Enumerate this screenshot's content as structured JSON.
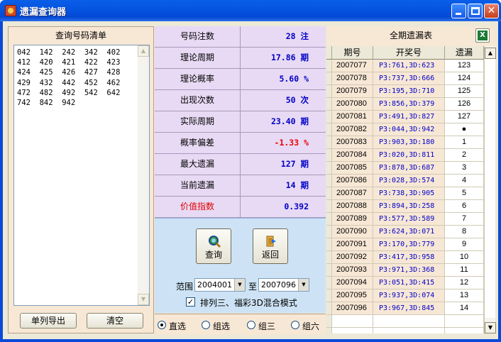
{
  "window": {
    "title": "遗漏查询器"
  },
  "left": {
    "header": "查询号码清单",
    "list_text": "042  142  242  342  402\n412  420  421  422  423\n424  425  426  427  428\n429  432  442  452  462\n472  482  492  542  642\n742  842  942",
    "export_button": "单列导出",
    "clear_button": "清空"
  },
  "stats": [
    {
      "label": "号码注数",
      "value": "28 注"
    },
    {
      "label": "理论周期",
      "value": "17.86 期"
    },
    {
      "label": "理论概率",
      "value": "5.60  %"
    },
    {
      "label": "出现次数",
      "value": "50 次"
    },
    {
      "label": "实际周期",
      "value": "23.40 期"
    },
    {
      "label": "概率偏差",
      "value": "-1.33 %"
    },
    {
      "label": "最大遗漏",
      "value": "127 期"
    },
    {
      "label": "当前遗漏",
      "value": "14 期"
    },
    {
      "label": "价值指数",
      "value": "0.392"
    }
  ],
  "actions": {
    "query": "查询",
    "back": "返回"
  },
  "range": {
    "label": "范围",
    "from": "2004001",
    "to_label": "至",
    "to": "2007096",
    "mixed_mode_label": "排列三、福彩3D混合模式",
    "mixed_mode_checked": true
  },
  "modes": [
    {
      "label": "直选",
      "selected": true
    },
    {
      "label": "组选",
      "selected": false
    },
    {
      "label": "组三",
      "selected": false
    },
    {
      "label": "组六",
      "selected": false
    }
  ],
  "table": {
    "title": "全期遗漏表",
    "export_icon": "excel-icon",
    "columns": [
      "期号",
      "开奖号",
      "遗漏"
    ],
    "rows": [
      [
        "2007077",
        "P3:761,3D:623",
        "123"
      ],
      [
        "2007078",
        "P3:737,3D:666",
        "124"
      ],
      [
        "2007079",
        "P3:195,3D:710",
        "125"
      ],
      [
        "2007080",
        "P3:856,3D:379",
        "126"
      ],
      [
        "2007081",
        "P3:491,3D:827",
        "127"
      ],
      [
        "2007082",
        "P3:044,3D:942",
        "●"
      ],
      [
        "2007083",
        "P3:903,3D:180",
        "1"
      ],
      [
        "2007084",
        "P3:020,3D:811",
        "2"
      ],
      [
        "2007085",
        "P3:878,3D:687",
        "3"
      ],
      [
        "2007086",
        "P3:028,3D:574",
        "4"
      ],
      [
        "2007087",
        "P3:738,3D:905",
        "5"
      ],
      [
        "2007088",
        "P3:894,3D:258",
        "6"
      ],
      [
        "2007089",
        "P3:577,3D:589",
        "7"
      ],
      [
        "2007090",
        "P3:624,3D:071",
        "8"
      ],
      [
        "2007091",
        "P3:170,3D:779",
        "9"
      ],
      [
        "2007092",
        "P3:417,3D:958",
        "10"
      ],
      [
        "2007093",
        "P3:971,3D:368",
        "11"
      ],
      [
        "2007094",
        "P3:051,3D:415",
        "12"
      ],
      [
        "2007095",
        "P3:937,3D:074",
        "13"
      ],
      [
        "2007096",
        "P3:967,3D:845",
        "14"
      ]
    ]
  }
}
